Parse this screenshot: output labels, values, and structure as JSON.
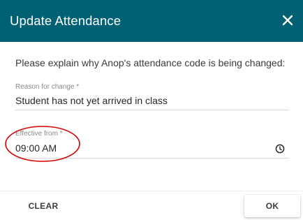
{
  "dialog": {
    "title": "Update Attendance",
    "close_icon": "close-icon",
    "prompt": "Please explain why Anop's attendance code is being changed:"
  },
  "reason": {
    "label": "Reason for change *",
    "value": "Student has not yet arrived in class"
  },
  "effective": {
    "label": "Effective from *",
    "value": "09:00 AM",
    "icon": "clock-icon"
  },
  "actions": {
    "clear_label": "CLEAR",
    "ok_label": "OK"
  },
  "colors": {
    "header_bg": "#006074",
    "annotation": "#d60000"
  }
}
